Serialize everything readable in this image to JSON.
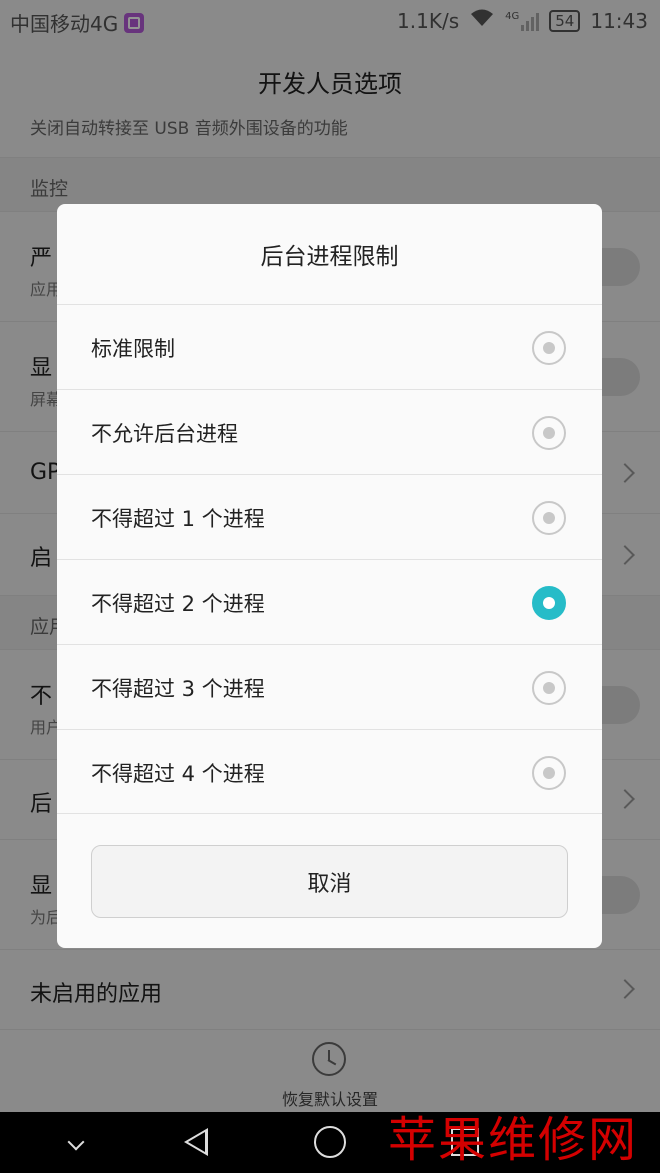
{
  "status_bar": {
    "carrier": "中国移动4G",
    "speed": "1.1K/s",
    "network": "4G",
    "battery": "54",
    "time": "11:43"
  },
  "screen": {
    "title": "开发人员选项"
  },
  "background_rows": {
    "top_partial_subtitle": "关闭自动转接至 USB 音频外围设备的功能",
    "monitor_header": "监控",
    "row1_title": "严",
    "row1_sub": "应用",
    "row2_title": "显",
    "row2_sub": "屏幕",
    "row3_title": "GP",
    "row4_title": "启",
    "apps_header": "应用",
    "row5_title": "不",
    "row5_sub": "用户",
    "row6_title": "后",
    "row7_title": "显",
    "row7_sub": "为后",
    "row8_title": "未启用的应用"
  },
  "restore": {
    "label": "恢复默认设置",
    "icon": "history-icon"
  },
  "dialog": {
    "title": "后台进程限制",
    "options": [
      {
        "label": "标准限制",
        "selected": false
      },
      {
        "label": "不允许后台进程",
        "selected": false
      },
      {
        "label": "不得超过 1 个进程",
        "selected": false
      },
      {
        "label": "不得超过 2 个进程",
        "selected": true
      },
      {
        "label": "不得超过 3 个进程",
        "selected": false
      },
      {
        "label": "不得超过 4 个进程",
        "selected": false
      }
    ],
    "cancel_label": "取消"
  },
  "watermark": "苹果维修网",
  "colors": {
    "accent": "#26bcc8",
    "watermark": "#d40000"
  }
}
